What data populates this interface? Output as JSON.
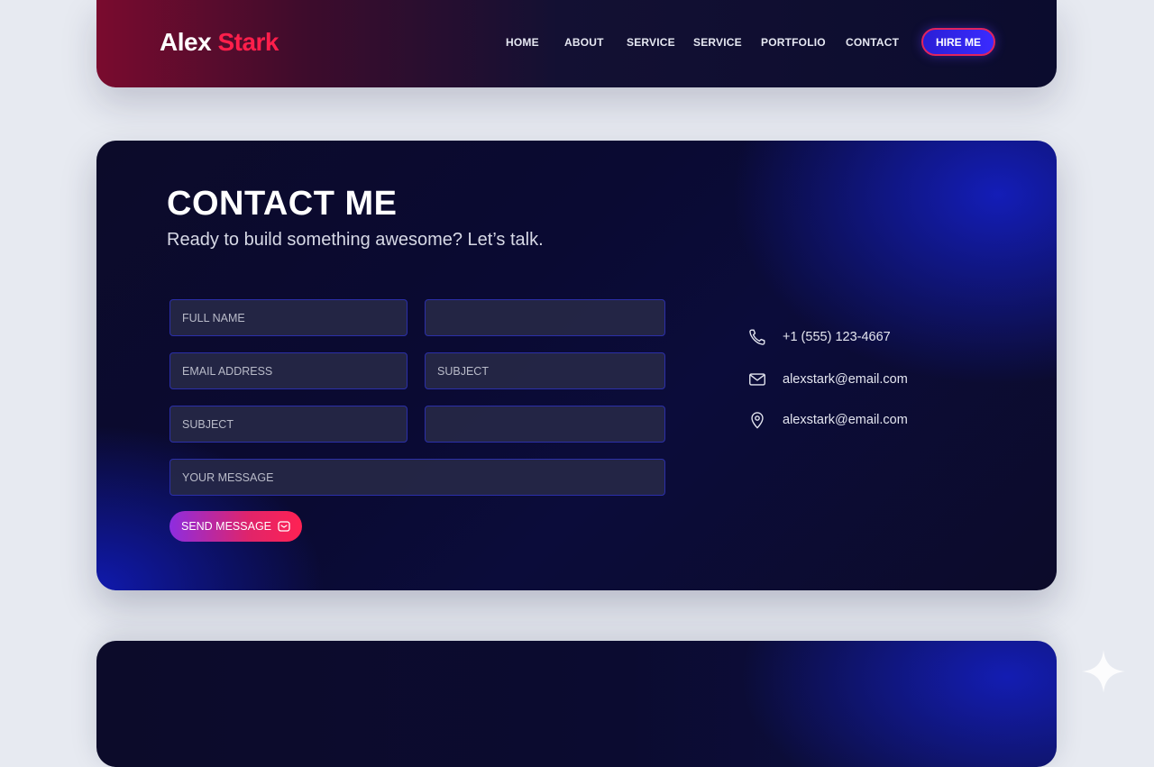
{
  "header": {
    "logo_first": "Alex",
    "logo_second": "Stark",
    "nav": [
      "HOME",
      "ABOUT",
      "SERVICE",
      "SERVICE",
      "PORTFOLIO",
      "CONTACT"
    ],
    "cta_label": "HIRE ME"
  },
  "contact": {
    "title": "CONTACT ME",
    "subtitle": "Ready to build something awesome? Let’s talk.",
    "fields": {
      "full_name_placeholder": "FULL NAME",
      "blank_1_placeholder": "",
      "email_placeholder": "EMAIL ADDRESS",
      "subject_right_placeholder": "SUBJECT",
      "subject_left_placeholder": "SUBJECT",
      "blank_2_placeholder": "",
      "message_placeholder": "YOUR MESSAGE"
    },
    "send_label": "SEND MESSAGE",
    "info": {
      "phone": "+1 (555) 123-4667",
      "email": "alexstark@email.com",
      "location": "alexstark@email.com"
    },
    "icons": {
      "phone": "phone-icon",
      "email": "mail-icon",
      "location": "map-pin-icon",
      "send": "message-icon"
    }
  },
  "colors": {
    "accent_red": "#ff1f4b",
    "accent_blue": "#2a1fd6",
    "field_border": "#2b2fa8"
  }
}
